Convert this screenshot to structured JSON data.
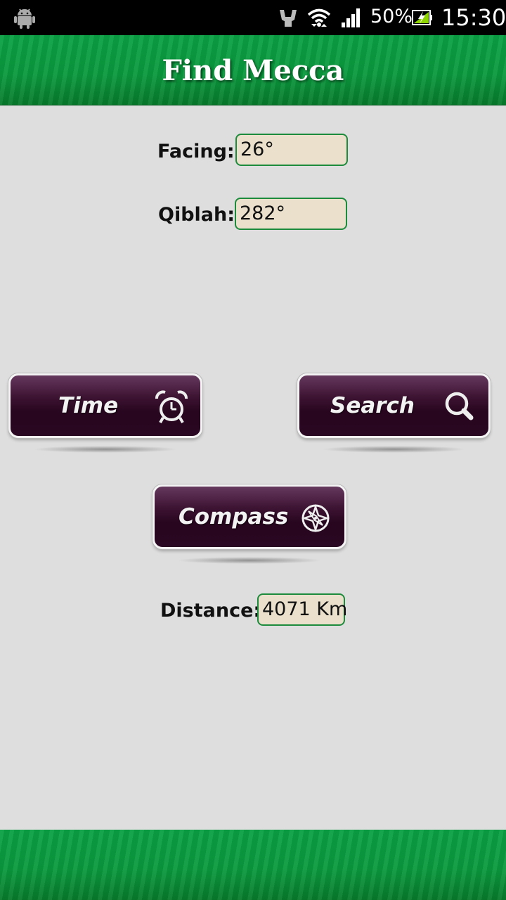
{
  "status_bar": {
    "battery_percent": "50%",
    "clock": "15:30",
    "icons": [
      "android-icon",
      "usb-debug-icon",
      "wifi-icon",
      "signal-icon",
      "battery-charging-icon"
    ]
  },
  "app": {
    "title": "Find Mecca"
  },
  "readings": {
    "facing_label": "Facing:",
    "facing_value": "26°",
    "qiblah_label": "Qiblah:",
    "qiblah_value": "282°",
    "distance_label": "Distance:",
    "distance_value": "4071 Km"
  },
  "buttons": {
    "time_label": "Time",
    "search_label": "Search",
    "compass_label": "Compass",
    "time_icon": "alarm-clock-icon",
    "search_icon": "magnifier-icon",
    "compass_icon": "compass-rose-icon"
  },
  "colors": {
    "header_green": "#0b9a3e",
    "button_purple": "#2a0722",
    "field_fill": "#eae0cc",
    "field_border": "#1c8b3c",
    "background": "#dedede"
  }
}
